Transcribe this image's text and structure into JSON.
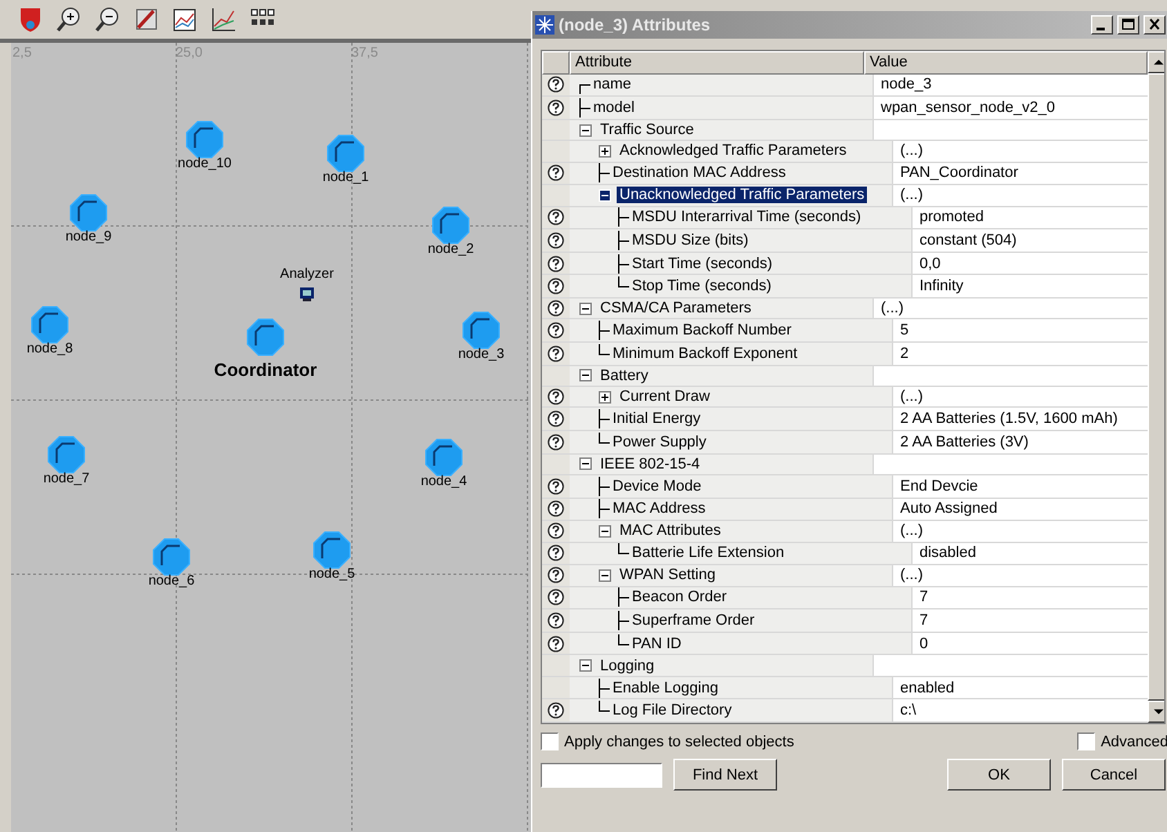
{
  "canvas": {
    "axis_labels": [
      "2,5",
      "25,0",
      "37,5"
    ],
    "nodes": [
      {
        "label": "node_10",
        "kind": "sensor"
      },
      {
        "label": "node_1",
        "kind": "sensor"
      },
      {
        "label": "node_9",
        "kind": "sensor"
      },
      {
        "label": "node_2",
        "kind": "sensor"
      },
      {
        "label": "Analyzer",
        "kind": "analyzer"
      },
      {
        "label": "Coordinator",
        "kind": "coordinator"
      },
      {
        "label": "node_8",
        "kind": "sensor"
      },
      {
        "label": "node_3",
        "kind": "sensor"
      },
      {
        "label": "node_7",
        "kind": "sensor"
      },
      {
        "label": "node_4",
        "kind": "sensor"
      },
      {
        "label": "node_6",
        "kind": "sensor"
      },
      {
        "label": "node_5",
        "kind": "sensor"
      }
    ]
  },
  "dialog": {
    "title": "(node_3) Attributes",
    "columns": [
      "Attribute",
      "Value"
    ],
    "rows": [
      {
        "label": "name",
        "value": "node_3",
        "help": true,
        "selected": false
      },
      {
        "label": "model",
        "value": "wpan_sensor_node_v2_0",
        "help": true,
        "selected": false
      },
      {
        "label": "Traffic Source",
        "help": false,
        "selected": false,
        "expanded": true,
        "children": [
          {
            "label": "Acknowledged Traffic Parameters",
            "value": "(...)",
            "help": false,
            "selected": false,
            "expanded": false
          },
          {
            "label": "Destination MAC Address",
            "value": "PAN_Coordinator",
            "help": true,
            "selected": false
          },
          {
            "label": "Unacknowledged Traffic Parameters",
            "value": "(...)",
            "help": false,
            "selected": true,
            "expanded": true,
            "children": [
              {
                "label": "MSDU Interarrival Time (seconds)",
                "value": "promoted",
                "help": true,
                "selected": false
              },
              {
                "label": "MSDU Size (bits)",
                "value": "constant (504)",
                "help": true,
                "selected": false
              },
              {
                "label": "Start Time (seconds)",
                "value": "0,0",
                "help": true,
                "selected": false
              },
              {
                "label": "Stop Time (seconds)",
                "value": "Infinity",
                "help": true,
                "selected": false
              }
            ]
          }
        ]
      },
      {
        "label": "CSMA/CA Parameters",
        "value": "(...)",
        "help": true,
        "selected": false,
        "expanded": true,
        "children": [
          {
            "label": "Maximum Backoff Number",
            "value": "5",
            "help": true,
            "selected": false
          },
          {
            "label": "Minimum Backoff Exponent",
            "value": "2",
            "help": true,
            "selected": false
          }
        ]
      },
      {
        "label": "Battery",
        "help": false,
        "selected": false,
        "expanded": true,
        "children": [
          {
            "label": "Current Draw",
            "value": "(...)",
            "help": true,
            "selected": false,
            "expanded": false
          },
          {
            "label": "Initial Energy",
            "value": "2 AA Batteries (1.5V, 1600 mAh)",
            "help": true,
            "selected": false
          },
          {
            "label": "Power Supply",
            "value": "2 AA Batteries (3V)",
            "help": true,
            "selected": false
          }
        ]
      },
      {
        "label": "IEEE 802-15-4",
        "help": false,
        "selected": false,
        "expanded": true,
        "children": [
          {
            "label": "Device Mode",
            "value": "End Devcie",
            "help": true,
            "selected": false
          },
          {
            "label": "MAC Address",
            "value": "Auto Assigned",
            "help": true,
            "selected": false
          },
          {
            "label": "MAC Attributes",
            "value": "(...)",
            "help": true,
            "selected": false,
            "expanded": true,
            "children": [
              {
                "label": "Batterie Life Extension",
                "value": "disabled",
                "help": true,
                "selected": false
              }
            ]
          },
          {
            "label": "WPAN Setting",
            "value": "(...)",
            "help": true,
            "selected": false,
            "expanded": true,
            "children": [
              {
                "label": "Beacon Order",
                "value": "7",
                "help": true,
                "selected": false
              },
              {
                "label": "Superframe Order",
                "value": "7",
                "help": true,
                "selected": false
              },
              {
                "label": "PAN ID",
                "value": "0",
                "help": true,
                "selected": false
              }
            ]
          }
        ]
      },
      {
        "label": "Logging",
        "help": false,
        "selected": false,
        "expanded": true,
        "children": [
          {
            "label": "Enable Logging",
            "value": "enabled",
            "help": false,
            "selected": false
          },
          {
            "label": "Log File Directory",
            "value": "c:\\",
            "help": true,
            "selected": false
          }
        ]
      }
    ],
    "apply_checkbox": {
      "label": "Apply changes to selected objects",
      "checked": false
    },
    "advanced_checkbox": {
      "label": "Advanced",
      "checked": false
    },
    "buttons": [
      "Find Next",
      "OK",
      "Cancel"
    ]
  }
}
